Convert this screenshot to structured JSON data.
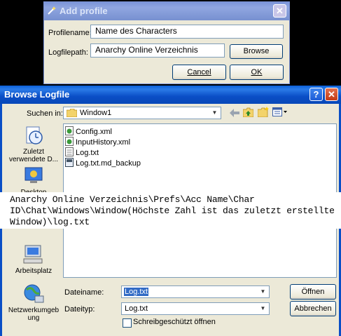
{
  "add_profile": {
    "title": "Add profile",
    "profile_label": "Profilename:",
    "profile_value": "Name des Characters",
    "logfile_label": "Logfilepath:",
    "logfile_value": "Anarchy Online Verzeichnis",
    "browse_label": "Browse",
    "cancel_label": "Cancel",
    "ok_label": "OK"
  },
  "browse_dialog": {
    "title": "Browse Logfile",
    "look_in_label": "Suchen in:",
    "look_in_value": "Window1",
    "places": [
      {
        "label": "Zuletzt verwendete D...",
        "icon": "recent-documents-icon"
      },
      {
        "label": "Desktop",
        "icon": "desktop-icon"
      },
      {
        "label": "Arbeitsplatz",
        "icon": "my-computer-icon"
      },
      {
        "label": "Netzwerkumgebung",
        "icon": "network-places-icon"
      }
    ],
    "files": [
      {
        "name": "Config.xml",
        "icon": "xml-file-icon"
      },
      {
        "name": "InputHistory.xml",
        "icon": "xml-file-icon"
      },
      {
        "name": "Log.txt",
        "icon": "text-file-icon"
      },
      {
        "name": "Log.txt.md_backup",
        "icon": "backup-file-icon"
      }
    ],
    "filename_label": "Dateiname:",
    "filename_value": "Log.txt",
    "filetype_label": "Dateityp:",
    "filetype_value": "Log.txt",
    "readonly_label": "Schreibgeschützt öffnen",
    "open_label": "Öffnen",
    "cancel_label": "Abbrechen"
  },
  "annotation": {
    "text": "Anarchy Online Verzeichnis\\Prefs\\Acc Name\\Char ID\\Chat\\Windows\\Window(Höchste Zahl ist das zuletzt erstellte Window)\\log.txt"
  },
  "colors": {
    "title_active": "#0a4ec6",
    "title_inactive": "#7b94d8",
    "dialog_bg": "#ece9d8",
    "selection": "#316ac5"
  }
}
